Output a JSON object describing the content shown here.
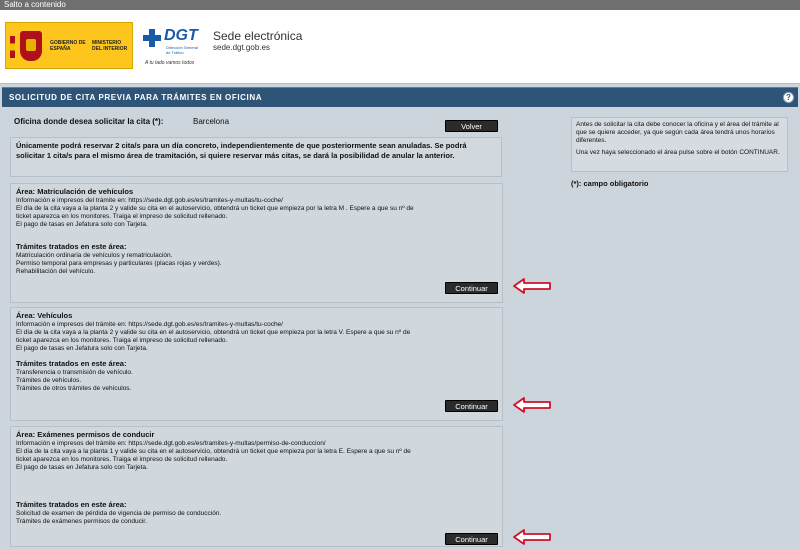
{
  "skip_link": "Salto a contenido",
  "header": {
    "gov_text1": "GOBIERNO DE ESPAÑA",
    "gov_text2": "MINISTERIO DEL INTERIOR",
    "dgt_name": "DGT",
    "dgt_sub": "Dirección General de Tráfico",
    "dgt_tagline": "A tu lado vamos todos",
    "site_title": "Sede electrónica",
    "site_url": "sede.dgt.gob.es"
  },
  "titlebar": {
    "title": "SOLICITUD DE CITA PREVIA PARA TRÁMITES EN OFICINA",
    "help": "?"
  },
  "office": {
    "label": "Oficina donde desea solicitar la cita (*):",
    "value": "Barcelona",
    "back_label": "Volver"
  },
  "notice": "Únicamente podrá reservar 2 cita/s para un día concreto, independientemente de que posteriormente sean anuladas. Se podrá solicitar 1 cita/s para el mismo área de tramitación, si quiere reservar más citas, se dará la posibilidad de anular la anterior.",
  "areas": [
    {
      "title": "Área: Matriculación de vehículos",
      "info": "Información e impresos del trámite en: https://sede.dgt.gob.es/es/tramites-y-multas/tu-coche/",
      "line1": "El día de la cita vaya a la planta 2 y valide su cita en el autoservicio, obtendrá un ticket que empieza por la letra M . Espere a que su nº de",
      "line2": "ticket aparezca en los monitores. Traiga el impreso de solicitud rellenado.",
      "line3": "El pago de tasas en Jefatura solo con Tarjeta.",
      "procedures_title": "Trámites tratados en este área:",
      "procedures": [
        "Matriculación ordinaria de vehículos y rematriculación.",
        "Permiso temporal para empresas y particulares (placas rojas y verdes).",
        "Rehabilitación del vehículo."
      ],
      "button": "Continuar"
    },
    {
      "title": "Área: Vehículos",
      "info": "Información e impresos del trámite en: https://sede.dgt.gob.es/es/tramites-y-multas/tu-coche/",
      "line1": "El día de la cita vaya a la planta 2 y valide su cita en el autoservicio, obtendrá un ticket que empieza por la letra V. Espere a que su nº de",
      "line2": "ticket aparezca en los monitores. Traiga el impreso de solicitud rellenado.",
      "line3": "El pago de tasas en Jefatura solo con Tarjeta.",
      "procedures_title": "Trámites tratados en este área:",
      "procedures": [
        "Transferencia o transmisión de vehículo.",
        "Trámites de vehículos.",
        "Trámites de otros trámites de vehículos."
      ],
      "button": "Continuar"
    },
    {
      "title": "Área: Exámenes permisos de conducir",
      "info": "Información e impresos del trámite en: https://sede.dgt.gob.es/es/tramites-y-multas/permiso-de-conduccion/",
      "line1": "El día de la cita vaya a la planta 1 y valide su cita en el autoservicio, obtendrá un ticket que empieza por la letra E. Espere a que su nº de",
      "line2": "ticket aparezca en los monitores. Traiga el impreso de solicitud rellenado.",
      "line3": "El pago de tasas en Jefatura solo con Tarjeta.",
      "procedures_title": "Trámites tratados en este área:",
      "procedures": [
        "Solicitud de examen de pérdida de vigencia de permiso de conducción.",
        "Trámites de exámenes permisos de conducir."
      ],
      "button": "Continuar"
    }
  ],
  "side": {
    "note1": "Antes de solicitar la cita debe conocer la oficina y el área del trámite al que se quiere acceder, ya que según cada área tendrá unos horarios diferentes.",
    "note2": "Una vez haya seleccionado el área pulse sobre el botón CONTINUAR.",
    "required": "(*): campo obligatorio"
  },
  "colors": {
    "titlebar": "#2e5578",
    "arrow": "#d0102a",
    "button": "#2b2b2b"
  }
}
